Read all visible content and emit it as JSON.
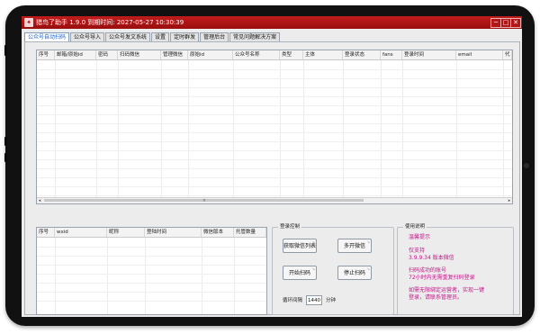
{
  "window": {
    "title": "猎鸟了助手 1.9.0   到期时间: 2027-05-27 10:30:39",
    "minimize_glyph": "─",
    "maximize_glyph": "□",
    "close_glyph": "✕"
  },
  "tabs": [
    {
      "label": "公众号自动扫码",
      "active": true
    },
    {
      "label": "公众号导入",
      "active": false
    },
    {
      "label": "公众号发文系统",
      "active": false
    },
    {
      "label": "设置",
      "active": false
    },
    {
      "label": "定时群发",
      "active": false
    },
    {
      "label": "管理后台",
      "active": false
    },
    {
      "label": "常见问题解决方案",
      "active": false
    }
  ],
  "account_table": {
    "columns": [
      "序号",
      "邮箱/原始id",
      "密码",
      "扫码微信",
      "管理微信",
      "原始id",
      "公众号名称",
      "类型",
      "主体",
      "登录状态",
      "fans",
      "登录时间",
      "email",
      "代"
    ]
  },
  "login_table": {
    "columns": [
      "序号",
      "wxid",
      "昵称",
      "登陆时间",
      "微信版本",
      "托管数量"
    ]
  },
  "login_control": {
    "title": "登录控制",
    "buttons": {
      "get_wechat_list": "获取微信列表",
      "multi_open": "多开微信",
      "start_scan": "开始扫码",
      "stop_scan": "停止扫码"
    },
    "corner_glyph": "↘",
    "interval_label": "循环间隔",
    "interval_value": "1440",
    "interval_unit": "分钟"
  },
  "usage": {
    "title": "使用说明",
    "lines": [
      "温馨提示",
      "仅支持",
      "3.9.9.34 版本微信",
      "扫码成功的账号",
      "72小时内无需重复扫码登录",
      "如需无限绑定运营者，实现一键",
      "登录，请联系管理员。"
    ]
  },
  "scrollbar": {
    "left_arrow": "◂",
    "right_arrow": "▸",
    "thumb_grip": "⦙⦙⦙"
  }
}
